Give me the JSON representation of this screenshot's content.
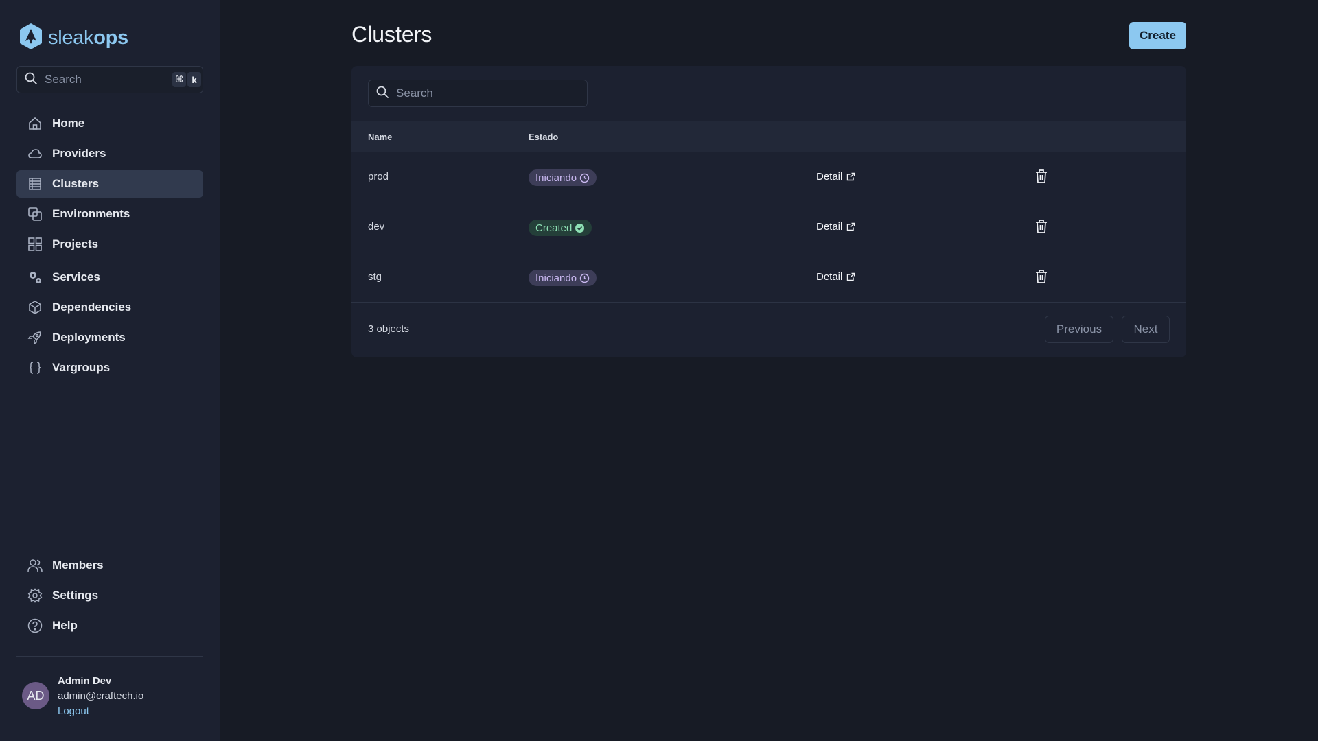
{
  "brand": {
    "name_light": "sleak",
    "name_bold": "ops"
  },
  "sidebar": {
    "search_placeholder": "Search",
    "shortcut_keys": [
      "⌘",
      "k"
    ],
    "items": [
      {
        "label": "Home",
        "icon": "home-icon"
      },
      {
        "label": "Providers",
        "icon": "cloud-icon"
      },
      {
        "label": "Clusters",
        "icon": "server-icon",
        "active": true
      },
      {
        "label": "Environments",
        "icon": "copy-icon"
      },
      {
        "label": "Projects",
        "icon": "grid-icon"
      },
      {
        "label": "Services",
        "icon": "gears-icon"
      },
      {
        "label": "Dependencies",
        "icon": "cube-icon"
      },
      {
        "label": "Deployments",
        "icon": "rocket-icon"
      },
      {
        "label": "Vargroups",
        "icon": "braces-icon"
      }
    ],
    "bottom_items": [
      {
        "label": "Members",
        "icon": "users-icon"
      },
      {
        "label": "Settings",
        "icon": "gear-icon"
      },
      {
        "label": "Help",
        "icon": "help-icon"
      }
    ],
    "user": {
      "initials": "AD",
      "name": "Admin Dev",
      "email": "admin@craftech.io",
      "logout_label": "Logout"
    }
  },
  "main": {
    "title": "Clusters",
    "create_label": "Create",
    "table": {
      "search_placeholder": "Search",
      "columns": [
        "Name",
        "Estado"
      ],
      "rows": [
        {
          "name": "prod",
          "status": "Iniciando",
          "status_kind": "pending",
          "detail_label": "Detail"
        },
        {
          "name": "dev",
          "status": "Created",
          "status_kind": "success",
          "detail_label": "Detail"
        },
        {
          "name": "stg",
          "status": "Iniciando",
          "status_kind": "pending",
          "detail_label": "Detail"
        }
      ],
      "count_label": "3 objects",
      "previous_label": "Previous",
      "next_label": "Next"
    }
  },
  "colors": {
    "accent": "#8cc8f0",
    "pending_badge": "#3d3d58",
    "success_badge": "#243f39"
  }
}
